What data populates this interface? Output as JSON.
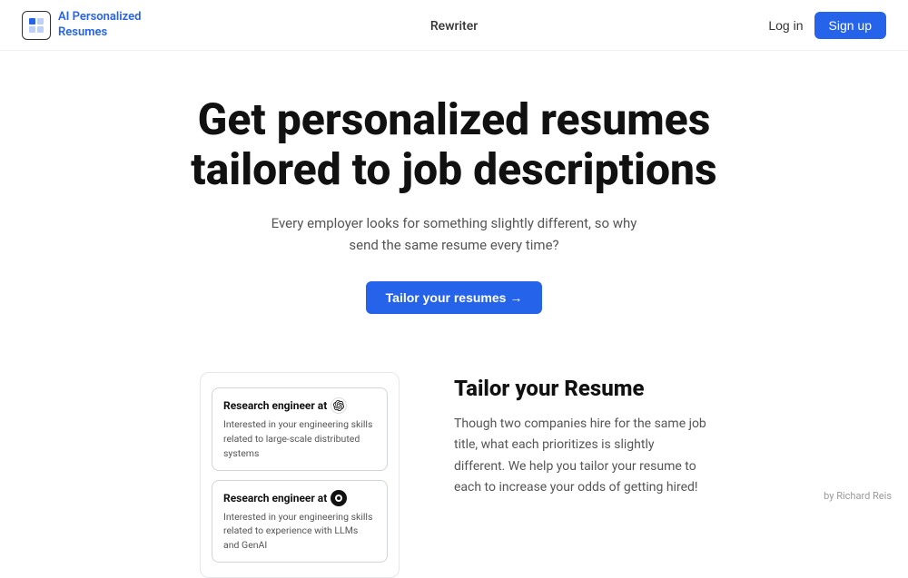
{
  "brand": {
    "name_line1": "AI Personalized",
    "name_line2": "Resumes",
    "accent_color": "#2563eb"
  },
  "nav": {
    "logo_alt": "AI Personalized Resumes logo",
    "links": [
      {
        "label": "Rewriter",
        "href": "#"
      }
    ],
    "login_label": "Log in",
    "signup_label": "Sign up"
  },
  "hero": {
    "headline": "Get personalized resumes tailored to job descriptions",
    "subheadline": "Every employer looks for something slightly different, so why send the same resume every time?",
    "cta_label": "Tailor your resumes →"
  },
  "feature": {
    "title": "Tailor your Resume",
    "description": "Though two companies hire for the same job title, what each prioritizes is slightly different. We help you tailor your resume to each to increase your odds of getting hired!"
  },
  "job_cards": [
    {
      "title_prefix": "Research engineer at",
      "company": "openai",
      "description": "Interested in your engineering skills related to large-scale distributed systems"
    },
    {
      "title_prefix": "Research engineer at",
      "company": "other",
      "description": "Interested in your engineering skills related to experience with LLMs and GenAI"
    }
  ],
  "footer": {
    "credit": "by Richard Reis"
  }
}
